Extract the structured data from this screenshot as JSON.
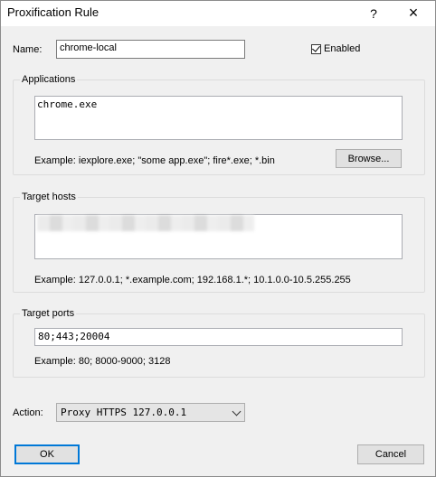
{
  "window": {
    "title": "Proxification Rule",
    "help_glyph": "?",
    "close_glyph": "×"
  },
  "rule": {
    "name_label": "Name:",
    "name_value": "chrome-local",
    "enabled_label": "Enabled",
    "enabled": true
  },
  "applications": {
    "title": "Applications",
    "value": "chrome.exe",
    "example": "Example: iexplore.exe; \"some app.exe\"; fire*.exe; *.bin",
    "browse_label": "Browse..."
  },
  "target_hosts": {
    "title": "Target hosts",
    "example": "Example: 127.0.0.1; *.example.com; 192.168.1.*; 10.1.0.0-10.5.255.255"
  },
  "target_ports": {
    "title": "Target ports",
    "value": "80;443;20004",
    "example": "Example: 80; 8000-9000; 3128"
  },
  "action": {
    "label": "Action:",
    "selected": "Proxy HTTPS 127.0.0.1"
  },
  "buttons": {
    "ok": "OK",
    "cancel": "Cancel"
  }
}
